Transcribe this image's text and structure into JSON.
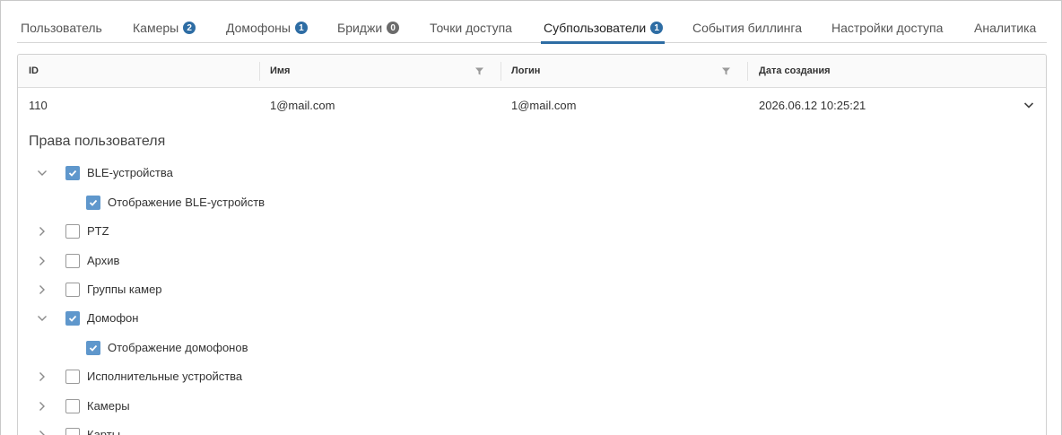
{
  "tabs": [
    {
      "label": "Пользователь",
      "badge": null,
      "active": false
    },
    {
      "label": "Камеры",
      "badge": "2",
      "badge_color": "#2e6da4",
      "active": false
    },
    {
      "label": "Домофоны",
      "badge": "1",
      "badge_color": "#2e6da4",
      "active": false
    },
    {
      "label": "Бриджи",
      "badge": "0",
      "badge_color": "#6b6b6b",
      "active": false
    },
    {
      "label": "Точки доступа",
      "badge": null,
      "active": false
    },
    {
      "label": "Субпользователи",
      "badge": "1",
      "badge_color": "#2e6da4",
      "active": true
    },
    {
      "label": "События биллинга",
      "badge": null,
      "active": false
    },
    {
      "label": "Настройки доступа",
      "badge": null,
      "active": false
    },
    {
      "label": "Аналитика",
      "badge": null,
      "active": false
    }
  ],
  "table": {
    "columns": {
      "id": "ID",
      "name": "Имя",
      "login": "Логин",
      "created": "Дата создания"
    },
    "row": {
      "id": "110",
      "name": "1@mail.com",
      "login": "1@mail.com",
      "created": "2026.06.12 10:25:21"
    }
  },
  "rights": {
    "title": "Права пользователя",
    "items": [
      {
        "label": "BLE-устройства",
        "checked": true,
        "expanded": true,
        "level": 0
      },
      {
        "label": "Отображение BLE-устройств",
        "checked": true,
        "level": 1
      },
      {
        "label": "PTZ",
        "checked": false,
        "expanded": false,
        "level": 0
      },
      {
        "label": "Архив",
        "checked": false,
        "expanded": false,
        "level": 0
      },
      {
        "label": "Группы камер",
        "checked": false,
        "expanded": false,
        "level": 0
      },
      {
        "label": "Домофон",
        "checked": true,
        "expanded": true,
        "level": 0
      },
      {
        "label": "Отображение домофонов",
        "checked": true,
        "level": 1
      },
      {
        "label": "Исполнительные устройства",
        "checked": false,
        "expanded": false,
        "level": 0
      },
      {
        "label": "Камеры",
        "checked": false,
        "expanded": false,
        "level": 0
      },
      {
        "label": "Карты",
        "checked": false,
        "expanded": false,
        "level": 0
      }
    ]
  },
  "colors": {
    "accent": "#2e6da4",
    "checkbox": "#5f97cc"
  }
}
